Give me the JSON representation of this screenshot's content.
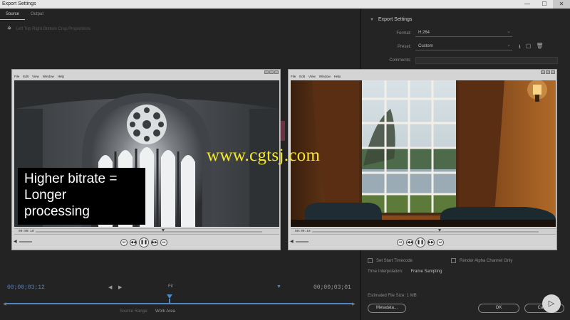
{
  "window": {
    "title": "Export Settings",
    "controls": [
      "—",
      "☐",
      "✕"
    ]
  },
  "tabs": [
    "Source",
    "Output"
  ],
  "crop_toolbar": {
    "label": "Left Top Right Bottom Crop Proportions"
  },
  "export_settings": {
    "title": "Export Settings",
    "format_label": "Format:",
    "format_value": "H.264",
    "preset_label": "Preset:",
    "preset_value": "Custom",
    "comments_label": "Comments:"
  },
  "bottom_options": {
    "set_start_timecode": "Set Start Timecode",
    "render_alpha": "Render Alpha Channel Only",
    "time_interp_label": "Time Interpolation:",
    "time_interp_value": "Frame Sampling",
    "estimated_size": "Estimated File Size: 1 MB",
    "metadata_button": "Metadata...",
    "ok_button": "OK",
    "cancel_button": "Cancel"
  },
  "timeline": {
    "start_tc": "00;00;03;12",
    "end_tc": "00;00;03;01",
    "fit_label": "Fit",
    "source_range_label": "Source Range:",
    "source_range_value": "Work Area"
  },
  "player_left": {
    "menu": [
      "File",
      "Edit",
      "View",
      "Window",
      "Help"
    ],
    "time": "00:00:10"
  },
  "player_right": {
    "menu": [
      "File",
      "Edit",
      "View",
      "Window",
      "Help"
    ],
    "time": "00:00:10"
  },
  "player_controls": [
    "⏮",
    "◀◀",
    "❚❚",
    "▶▶",
    "⏭"
  ],
  "caption": {
    "line1": "Higher bitrate =",
    "line2": "Longer",
    "line3": "processing"
  },
  "watermark": "www.cgtsj.com",
  "colors": {
    "accent": "#4e87c9",
    "watermark": "#f6e829"
  }
}
